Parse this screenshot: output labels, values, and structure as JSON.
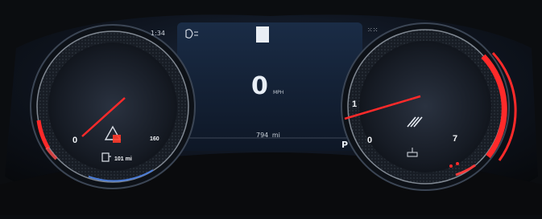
{
  "top": {
    "left_indicator": "1:34",
    "right_indicator": "⁙⁙"
  },
  "center": {
    "speed": "0",
    "speed_unit": "MPH",
    "odometer": "794",
    "odometer_unit": "mi",
    "gear": "P"
  },
  "speedometer": {
    "speed_value": 0,
    "max_speed": "160",
    "min_label": "0",
    "range_text": "101 mi"
  },
  "tachometer": {
    "rpm_value": 1,
    "labels": [
      "0",
      "1",
      "7"
    ]
  },
  "colors": {
    "accent_red": "#ff2a2a",
    "cluster_bg": "#0b0d10",
    "display_blue": "#1a2c46"
  },
  "icons": {
    "warning": "warning-triangle-icon",
    "fuel": "fuel-pump-icon",
    "oil": "oil-can-icon",
    "lights": "headlight-icon",
    "pattern": "hatch-icon"
  }
}
